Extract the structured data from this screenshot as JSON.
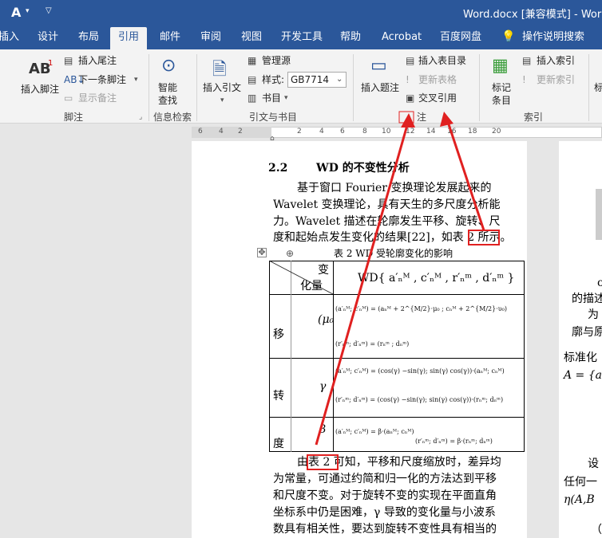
{
  "titlebar": {
    "font_icon": "A",
    "title": "Word.docx [兼容模式] - Wor"
  },
  "tabs": [
    "插入",
    "设计",
    "布局",
    "引用",
    "邮件",
    "审阅",
    "视图",
    "开发工具",
    "帮助",
    "Acrobat",
    "百度网盘"
  ],
  "active_tab": "引用",
  "tell_me": "操作说明搜索",
  "ribbon": {
    "footnote": {
      "insert_footnote": "插入脚注",
      "ab_icon": "AB",
      "insert_endnote": "插入尾注",
      "next_footnote": "下一条脚注",
      "show_notes": "显示备注",
      "group": "脚注"
    },
    "research": {
      "smart_lookup": "智能查找",
      "group": "信息检索"
    },
    "citations": {
      "insert_citation": "插入引文",
      "manage_sources": "管理源",
      "style_label": "样式:",
      "style_value": "GB7714",
      "bibliography": "书目",
      "group": "引文与书目"
    },
    "captions": {
      "insert_caption": "插入题注",
      "insert_table_of_figures": "插入表目录",
      "update_table": "更新表格",
      "cross_reference": "交叉引用",
      "group": "注"
    },
    "index": {
      "mark_entry": "标记条目",
      "insert_index": "插入索引",
      "update_index": "更新索引",
      "group": "索引"
    },
    "cut_label": "标"
  },
  "ruler": {
    "ticks": [
      "6",
      "4",
      "2",
      "",
      "2",
      "4",
      "6",
      "8",
      "10",
      "12",
      "14",
      "16",
      "18",
      "20"
    ]
  },
  "document": {
    "heading_num": "2.2",
    "heading": "WD 的不变性分析",
    "para1": [
      "基于窗口 Fourier 变换理论发展起来的",
      "Wavelet 变换理论，具有天生的多尺度分析能",
      "力。Wavelet 描述在轮廓发生平移、旋转、尺",
      "度和起始点发生变化的结果[22]，如表 2 所示。"
    ],
    "table_caption": "表 2 WD 受轮廓变化的影响",
    "table": {
      "header_left": [
        "变",
        "化量"
      ],
      "header_right": "WD{ a′ₙᴹ , c′ₙᴹ , r′ₙᵐ , d′ₙᵐ }",
      "rows": [
        {
          "label": "移",
          "symbol": "(μ₀",
          "lines": [
            "(a′ₙᴹ; c′ₙᴹ) = (aₙᴹ + 2^{M/2}·μ₀ ; cₙᴹ + 2^{M/2}·υ₀)",
            "(r′ₙᵐ; d′ₙᵐ) = (rₙᵐ ; dₙᵐ)"
          ]
        },
        {
          "label": "转",
          "symbol": "γ",
          "lines": [
            "(a′ₙᴹ; c′ₙᴹ) = (cos(γ) −sin(γ); sin(γ) cos(γ))·(aₙᴹ; cₙᴹ)",
            "(r′ₙᵐ; d′ₙᵐ) = (cos(γ) −sin(γ); sin(γ) cos(γ))·(rₙᵐ; dₙᵐ)"
          ]
        },
        {
          "label": "度",
          "symbol": "β",
          "lines": [
            "(a′ₙᴹ; c′ₙᴹ) = β·(aₙᴹ; cₙᴹ)",
            "(r′ₙᵐ; d′ₙᵐ) = β·(rₙᵐ; dₙᵐ)"
          ]
        }
      ]
    },
    "para2": [
      "由表 2 可知，平移和尺度缩放时，差异均",
      "为常量，可通过约简和归一化的方法达到平移",
      "和尺度不变。对于旋转不变的实现在平面直角",
      "坐标系中仍是困难，γ 导致的变化量与小波系",
      "数具有相关性，要达到旋转不变性具有相当的"
    ],
    "right_col": [
      "o",
      "的描述",
      "为",
      "廓与原",
      "标准化",
      "A = {a",
      "设",
      "任何一",
      "η(A,B",
      "（"
    ]
  },
  "colors": {
    "title_blue": "#2b579a",
    "annotation_red": "#e02020"
  }
}
